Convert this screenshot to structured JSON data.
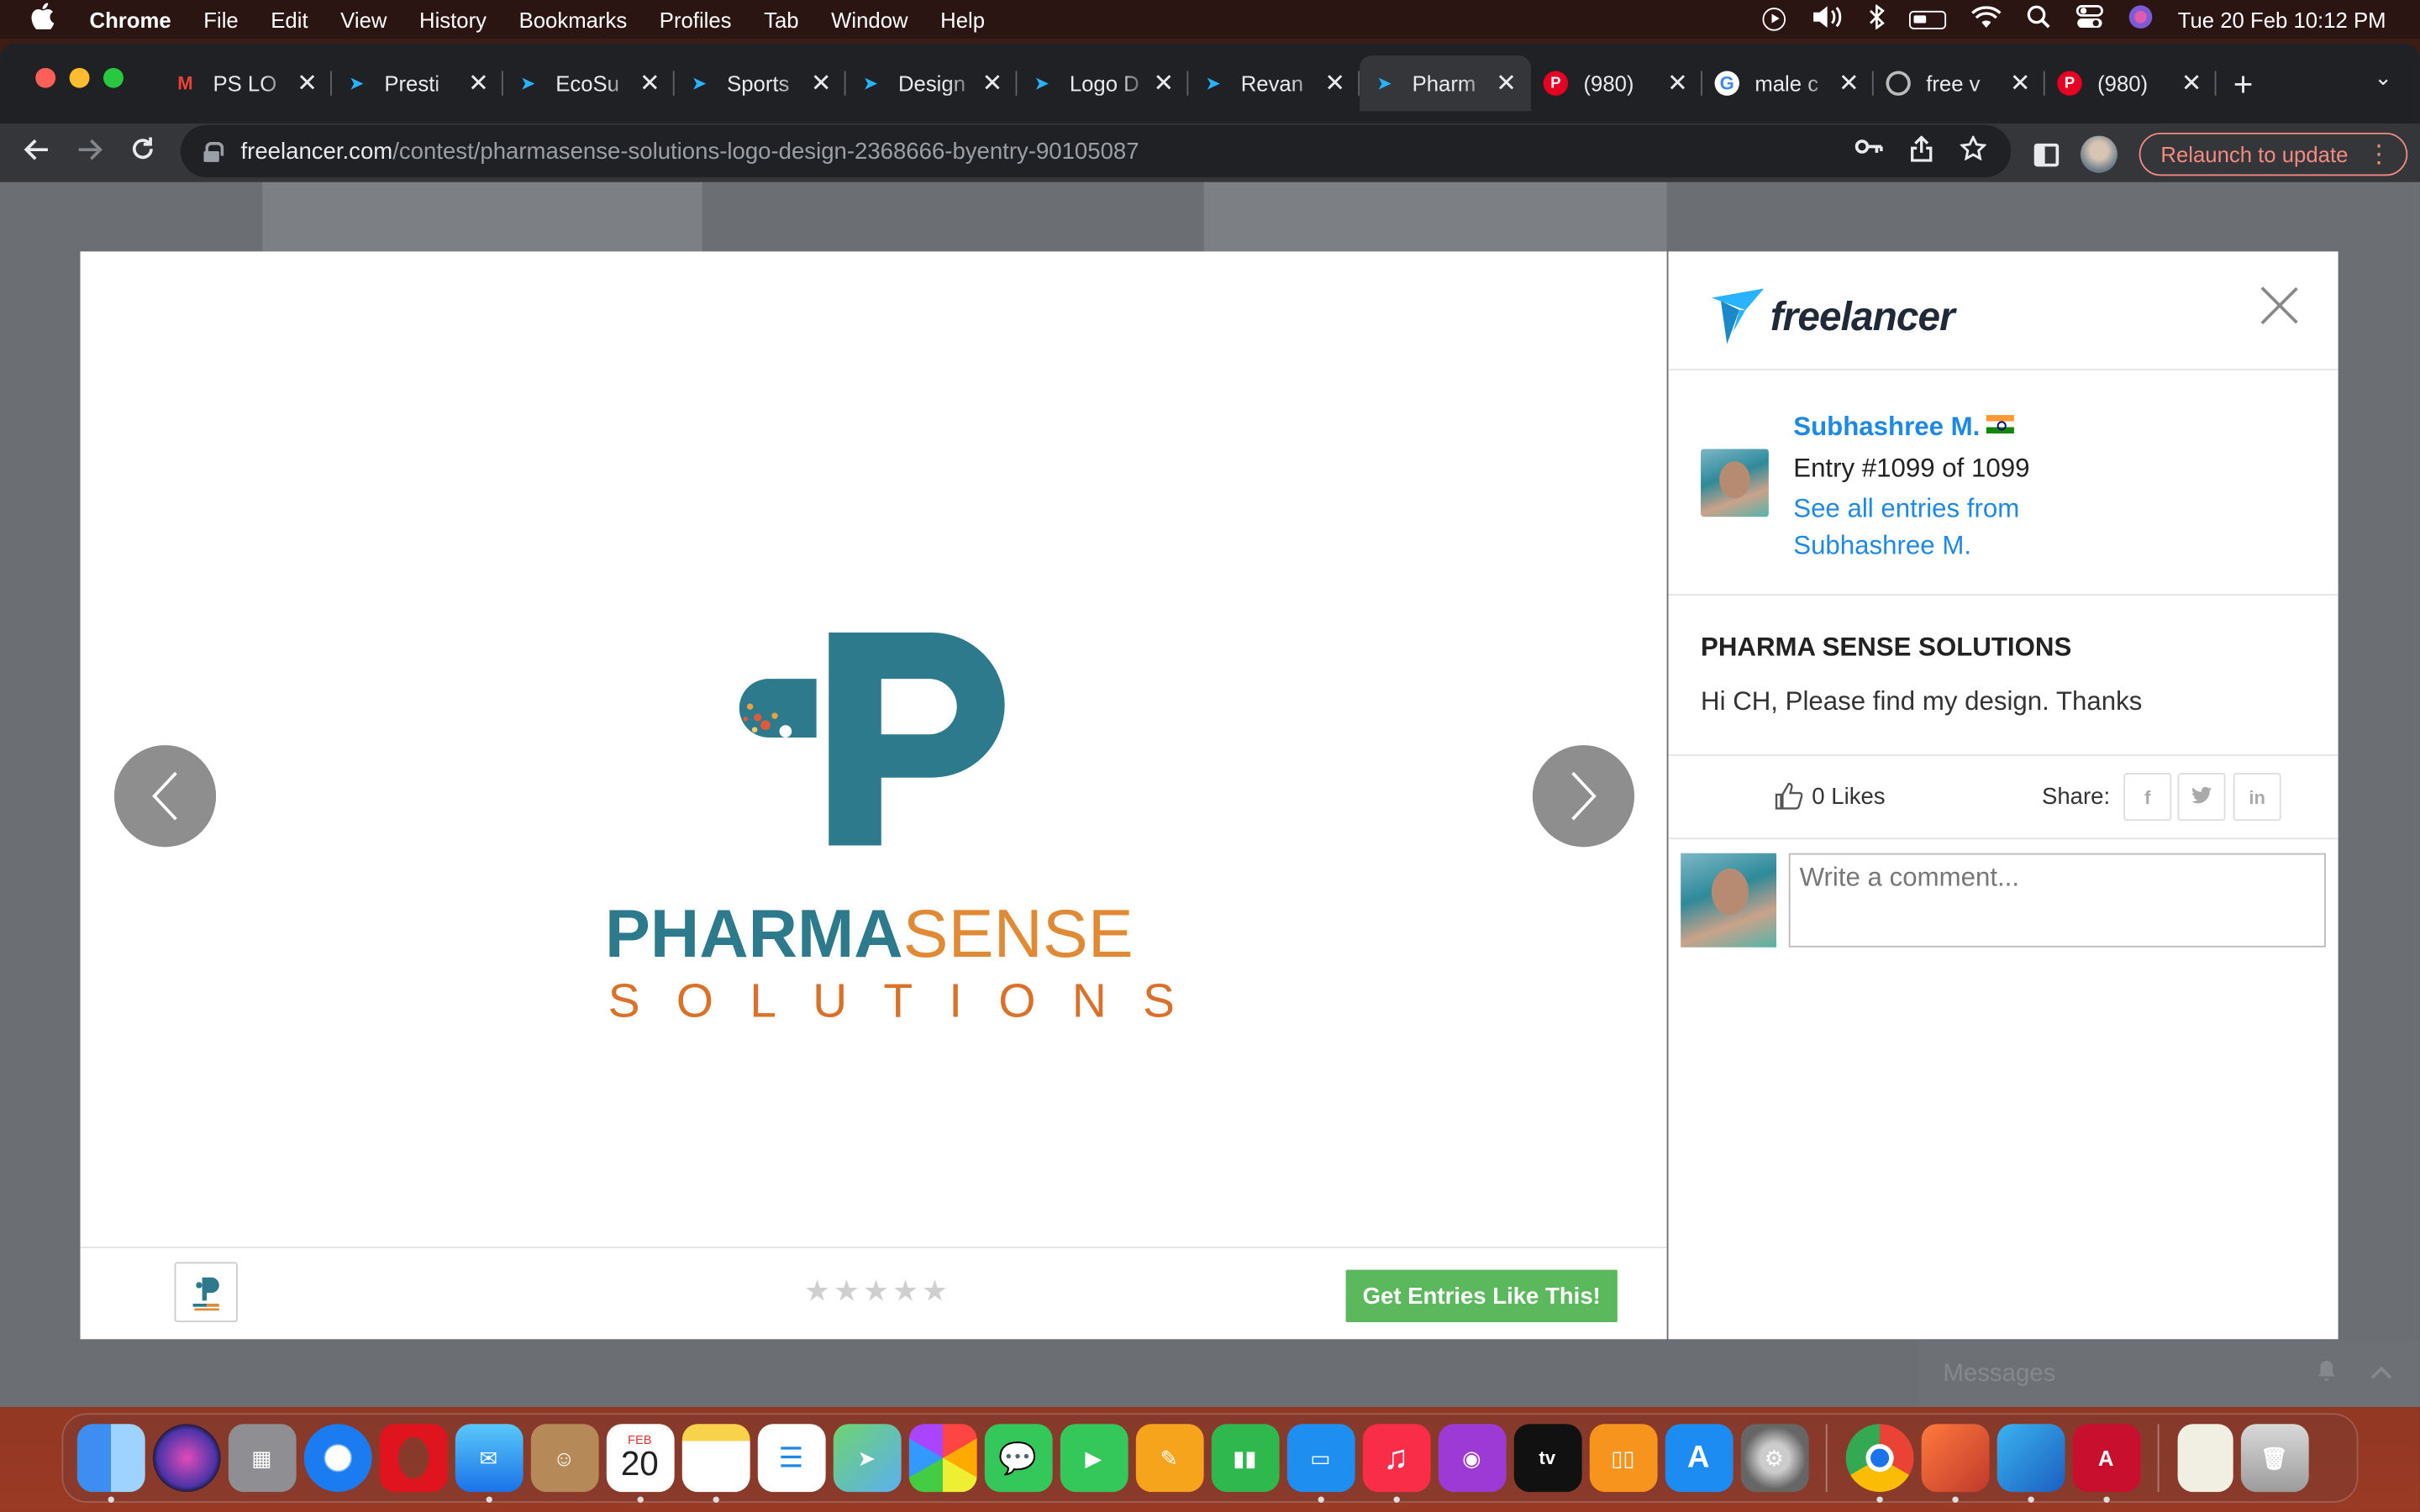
{
  "menubar": {
    "app_name": "Chrome",
    "items": [
      "File",
      "Edit",
      "View",
      "History",
      "Bookmarks",
      "Profiles",
      "Tab",
      "Window",
      "Help"
    ],
    "datetime": "Tue 20 Feb  10:12 PM"
  },
  "tabs": [
    {
      "title": "PS LO",
      "icon": "gmail-icon"
    },
    {
      "title": "Presti",
      "icon": "freelancer-icon"
    },
    {
      "title": "EcoSu",
      "icon": "freelancer-icon"
    },
    {
      "title": "Sports",
      "icon": "freelancer-icon"
    },
    {
      "title": "Design",
      "icon": "freelancer-icon"
    },
    {
      "title": "Logo D",
      "icon": "freelancer-icon"
    },
    {
      "title": "Revan",
      "icon": "freelancer-icon"
    },
    {
      "title": "Pharm",
      "icon": "freelancer-icon",
      "active": true
    },
    {
      "title": "(980)",
      "icon": "pinterest-icon"
    },
    {
      "title": "male c",
      "icon": "google-icon"
    },
    {
      "title": "free v",
      "icon": "freevector-icon"
    },
    {
      "title": "(980)",
      "icon": "pinterest-icon"
    }
  ],
  "toolbar": {
    "url_host": "freelancer.com",
    "url_path": "/contest/pharmasense-solutions-logo-design-2368666-byentry-90105087",
    "relaunch_label": "Relaunch to update"
  },
  "entry": {
    "logo_word_1": "PHARMA",
    "logo_word_2": "SENSE",
    "logo_word_3": "SOLUTIONS",
    "rating_stars": 0,
    "cta_label": "Get Entries Like This!"
  },
  "panel": {
    "brand": "freelancer",
    "user_name": "Subhashree M.",
    "entry_number": "Entry #1099 of 1099",
    "see_all": "See all entries from Subhashree M.",
    "title": "PHARMA SENSE SOLUTIONS",
    "description": "Hi CH, Please find my design. Thanks",
    "likes": "0 Likes",
    "share_label": "Share:",
    "comment_placeholder": "Write a comment..."
  },
  "messages": {
    "label": "Messages"
  },
  "dock": {
    "calendar_month": "FEB",
    "calendar_day": "20"
  },
  "colors": {
    "brand_teal": "#2c7a8c",
    "brand_orange": "#e08a36",
    "cta_green": "#5cb85c",
    "link_blue": "#1e88e5"
  }
}
